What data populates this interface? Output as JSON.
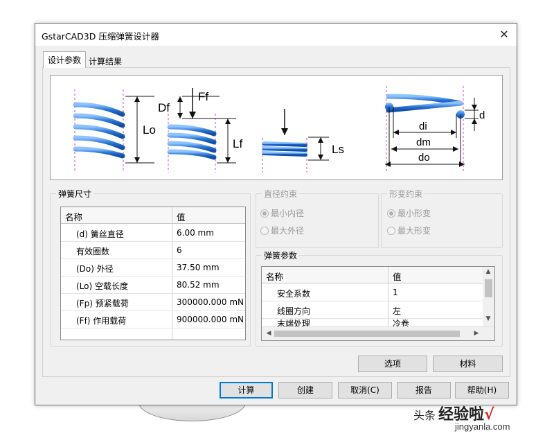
{
  "dialog": {
    "title": "GstarCAD3D 压缩弹簧设计器",
    "close_glyph": "✕"
  },
  "tabs": [
    {
      "label": "设计参数",
      "active": true
    },
    {
      "label": "计算结果",
      "active": false
    }
  ],
  "diagram_labels": {
    "lo": "Lo",
    "df": "Df",
    "ff": "Ff",
    "lf": "Lf",
    "ls": "Ls",
    "di": "di",
    "dm": "dm",
    "do": "do",
    "d": "d"
  },
  "spring_size": {
    "group_title": "弹簧尺寸",
    "headers": {
      "name": "名称",
      "value": "值"
    },
    "rows": [
      {
        "name": "(d) 簧丝直径",
        "value": "6.00 mm"
      },
      {
        "name": "有效圈数",
        "value": "6"
      },
      {
        "name": "(Do) 外径",
        "value": "37.50 mm"
      },
      {
        "name": "(Lo) 空载长度",
        "value": "80.52 mm"
      },
      {
        "name": "(Fp) 预紧载荷",
        "value": "300000.000 mN"
      },
      {
        "name": "(Ff) 作用载荷",
        "value": "900000.000 mN"
      }
    ]
  },
  "diameter_constraint": {
    "group_title": "直径约束",
    "options": [
      "最小内径",
      "最大外径"
    ],
    "selected_index": 0
  },
  "deform_constraint": {
    "group_title": "形变约束",
    "options": [
      "最小形变",
      "最大形变"
    ],
    "selected_index": 0
  },
  "spring_params": {
    "group_title": "弹簧参数",
    "headers": {
      "name": "名称",
      "value": "值"
    },
    "rows": [
      {
        "name": "安全系数",
        "value": "1"
      },
      {
        "name": "线圈方向",
        "value": "左"
      },
      {
        "name": "末端处理",
        "value": "冷卷"
      }
    ]
  },
  "panel_buttons": {
    "options": "选项",
    "material": "材料"
  },
  "footer_buttons": {
    "calculate": "计算",
    "create": "创建",
    "cancel": "取消(C)",
    "report": "报告",
    "help": "帮助(H)"
  },
  "watermark": {
    "source": "头条",
    "brand": "经验啦",
    "check": "√",
    "url": "jingyanla.com"
  },
  "colors": {
    "spring": "#2b78d6",
    "accent": "#0078d7"
  }
}
